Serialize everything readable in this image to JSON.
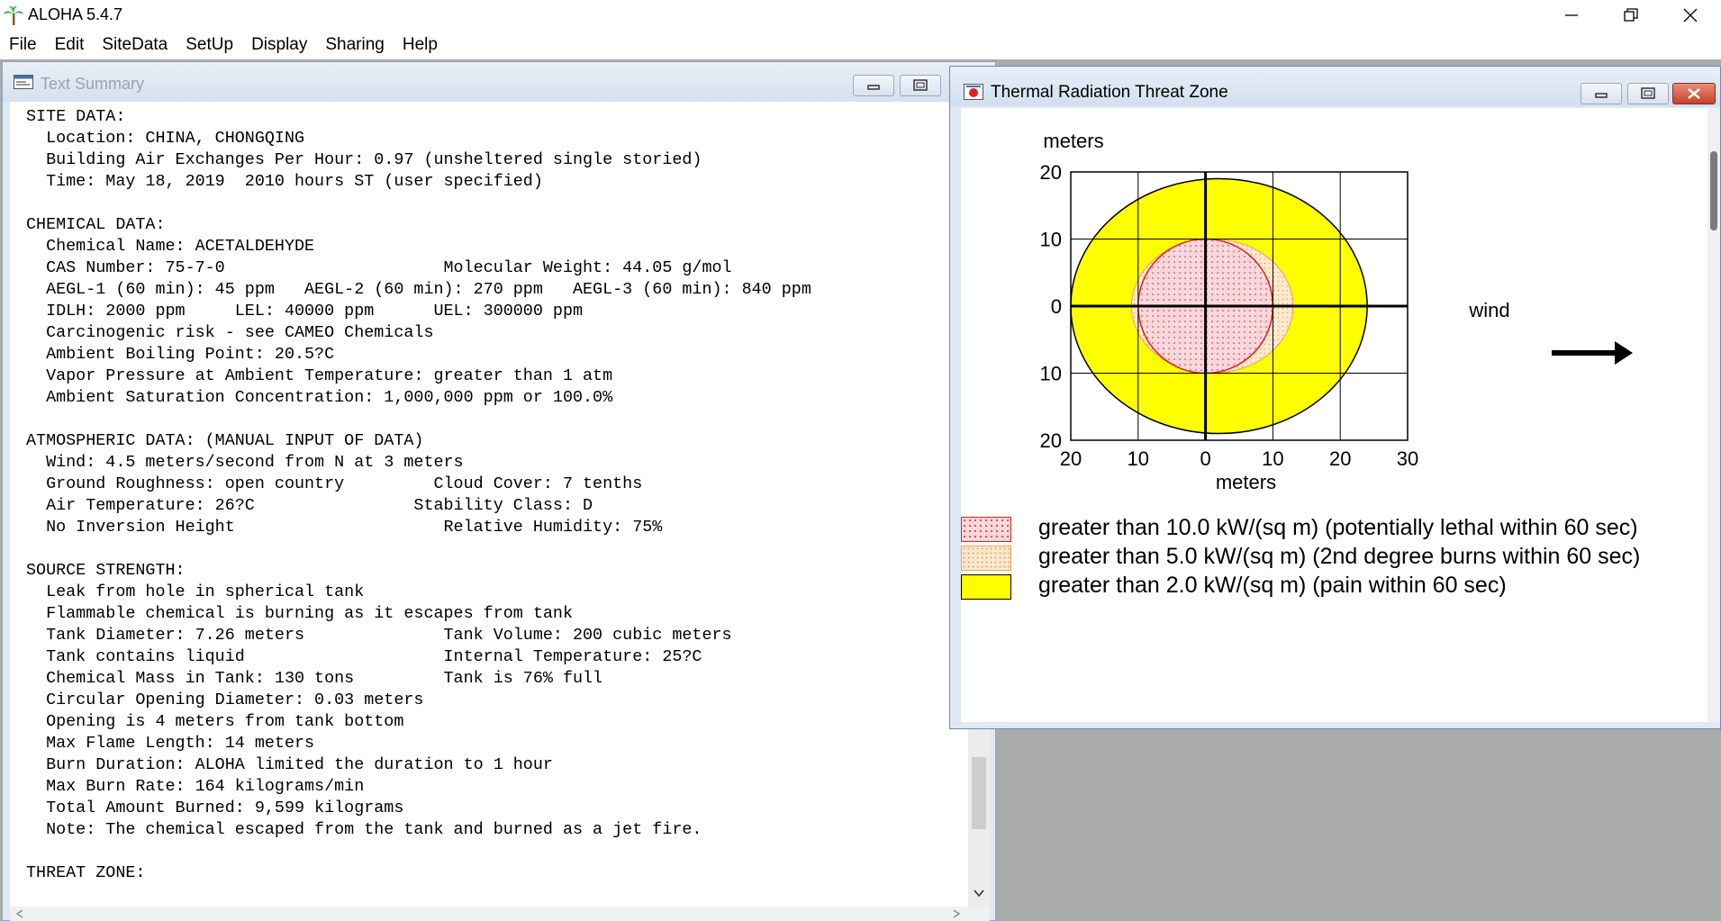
{
  "app": {
    "title": "ALOHA 5.4.7",
    "menu": [
      "File",
      "Edit",
      "SiteData",
      "SetUp",
      "Display",
      "Sharing",
      "Help"
    ]
  },
  "text_summary": {
    "title": "Text Summary",
    "lines": [
      "SITE DATA:",
      "  Location: CHINA, CHONGQING",
      "  Building Air Exchanges Per Hour: 0.97 (unsheltered single storied)",
      "  Time: May 18, 2019  2010 hours ST (user specified)",
      "",
      "CHEMICAL DATA:",
      "  Chemical Name: ACETALDEHYDE",
      "  CAS Number: 75-7-0                      Molecular Weight: 44.05 g/mol",
      "  AEGL-1 (60 min): 45 ppm   AEGL-2 (60 min): 270 ppm   AEGL-3 (60 min): 840 ppm",
      "  IDLH: 2000 ppm     LEL: 40000 ppm      UEL: 300000 ppm",
      "  Carcinogenic risk - see CAMEO Chemicals",
      "  Ambient Boiling Point: 20.5?C",
      "  Vapor Pressure at Ambient Temperature: greater than 1 atm",
      "  Ambient Saturation Concentration: 1,000,000 ppm or 100.0%",
      "",
      "ATMOSPHERIC DATA: (MANUAL INPUT OF DATA)",
      "  Wind: 4.5 meters/second from N at 3 meters",
      "  Ground Roughness: open country         Cloud Cover: 7 tenths",
      "  Air Temperature: 26?C                Stability Class: D",
      "  No Inversion Height                     Relative Humidity: 75%",
      "",
      "SOURCE STRENGTH:",
      "  Leak from hole in spherical tank",
      "  Flammable chemical is burning as it escapes from tank",
      "  Tank Diameter: 7.26 meters              Tank Volume: 200 cubic meters",
      "  Tank contains liquid                    Internal Temperature: 25?C",
      "  Chemical Mass in Tank: 130 tons         Tank is 76% full",
      "  Circular Opening Diameter: 0.03 meters",
      "  Opening is 4 meters from tank bottom",
      "  Max Flame Length: 14 meters",
      "  Burn Duration: ALOHA limited the duration to 1 hour",
      "  Max Burn Rate: 164 kilograms/min",
      "  Total Amount Burned: 9,599 kilograms",
      "  Note: The chemical escaped from the tank and burned as a jet fire.",
      "",
      "THREAT ZONE:"
    ]
  },
  "threat_zone": {
    "title": "Thermal Radiation Threat Zone",
    "y_unit": "meters",
    "x_unit": "meters",
    "wind_label": "wind",
    "y_ticks": [
      "20",
      "10",
      "0",
      "10",
      "20"
    ],
    "x_ticks": [
      "20",
      "10",
      "0",
      "10",
      "20",
      "30"
    ],
    "legend": [
      {
        "label": "greater than 10.0 kW/(sq m) (potentially lethal within 60 sec)",
        "color": "#f8d8dc",
        "border": "#e02020"
      },
      {
        "label": "greater than 5.0 kW/(sq m) (2nd degree burns within 60 sec)",
        "color": "#fbe3c4",
        "border": "#f0a060"
      },
      {
        "label": "greater than 2.0 kW/(sq m) (pain within 60 sec)",
        "color": "#ffff00",
        "border": "#000000"
      }
    ],
    "zones": [
      {
        "name": "yellow",
        "cx": 2,
        "cy": 0,
        "rx": 22,
        "ry": 19
      },
      {
        "name": "orange",
        "cx": 1,
        "cy": 0,
        "rx": 12,
        "ry": 10
      },
      {
        "name": "red",
        "cx": 0,
        "cy": 0,
        "rx": 10,
        "ry": 10
      }
    ],
    "x_range": [
      -20,
      30
    ],
    "y_range": [
      -20,
      20
    ]
  }
}
